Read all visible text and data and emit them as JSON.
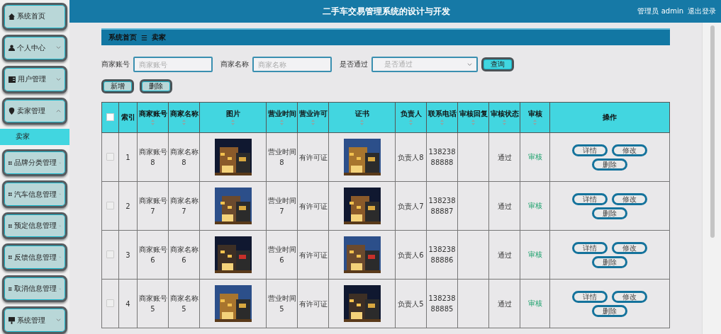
{
  "sidebar": {
    "items": [
      {
        "label": "系统首页"
      },
      {
        "label": "个人中心",
        "expanded": false
      },
      {
        "label": "用户管理",
        "expanded": false
      },
      {
        "label": "卖家管理",
        "expanded": true,
        "children": [
          {
            "label": "卖家",
            "selected": true
          }
        ]
      },
      {
        "label": "品牌分类管理",
        "expanded": false
      },
      {
        "label": "汽车信息管理",
        "expanded": false
      },
      {
        "label": "预定信息管理",
        "expanded": false
      },
      {
        "label": "反馈信息管理",
        "expanded": false
      },
      {
        "label": "取消信息管理",
        "expanded": false
      },
      {
        "label": "系统管理",
        "expanded": false
      }
    ]
  },
  "header": {
    "title": "二手车交易管理系统的设计与开发",
    "user": "管理员 admin",
    "logout": "退出登录"
  },
  "breadcrumb": {
    "home": "系统首页",
    "separator": "☰",
    "current": "卖家"
  },
  "filters": [
    {
      "kind": "input",
      "label": "商家账号",
      "placeholder": "商家账号"
    },
    {
      "kind": "input",
      "label": "商家名称",
      "placeholder": "商家名称"
    },
    {
      "kind": "select",
      "label": "是否通过",
      "placeholder": "是否通过"
    }
  ],
  "search_button": "查询",
  "actions": [
    "新增",
    "删除"
  ],
  "table": {
    "all_checked": false,
    "columns": [
      {
        "kind": "check",
        "sortable": false
      },
      {
        "kind": "text",
        "label": "索引",
        "sortable": false
      },
      {
        "kind": "text",
        "label": "商家账号",
        "sortable": true
      },
      {
        "kind": "text",
        "label": "商家名称",
        "sortable": true
      },
      {
        "kind": "picture",
        "label": "图片",
        "sortable": true
      },
      {
        "kind": "text",
        "label": "营业时间",
        "sortable": true
      },
      {
        "kind": "text",
        "label": "营业许可",
        "sortable": true
      },
      {
        "kind": "picture",
        "label": "证书",
        "sortable": true
      },
      {
        "kind": "text",
        "label": "负责人",
        "sortable": true
      },
      {
        "kind": "text",
        "label": "联系电话",
        "sortable": true
      },
      {
        "kind": "text",
        "label": "审核回复",
        "sortable": true
      },
      {
        "kind": "text",
        "label": "审核状态",
        "sortable": true
      },
      {
        "kind": "link",
        "label": "审核",
        "sortable": true
      },
      {
        "kind": "ops",
        "label": "操作",
        "sortable": false
      }
    ],
    "rows": [
      {
        "checked": false,
        "cells": [
          "",
          "1",
          "商家账号8",
          "商家名称8",
          "",
          "营业时间8",
          "有许可证",
          "",
          "负责人8",
          "13823888888",
          "",
          "通过",
          "审核",
          ""
        ],
        "buttons": [
          "详情",
          "修改",
          "删除"
        ]
      },
      {
        "checked": false,
        "cells": [
          "",
          "2",
          "商家账号7",
          "商家名称7",
          "",
          "营业时间7",
          "有许可证",
          "",
          "负责人7",
          "13823888887",
          "",
          "通过",
          "审核",
          ""
        ],
        "buttons": [
          "详情",
          "修改",
          "删除"
        ]
      },
      {
        "checked": false,
        "cells": [
          "",
          "3",
          "商家账号6",
          "商家名称6",
          "",
          "营业时间6",
          "有许可证",
          "",
          "负责人6",
          "13823888886",
          "",
          "通过",
          "审核",
          ""
        ],
        "buttons": [
          "详情",
          "修改",
          "删除"
        ]
      },
      {
        "checked": false,
        "cells": [
          "",
          "4",
          "商家账号5",
          "商家名称5",
          "",
          "营业时间5",
          "有许可证",
          "",
          "负责人5",
          "13823888885",
          "",
          "通过",
          "审核",
          ""
        ],
        "buttons": [
          "详情",
          "修改",
          "删除"
        ]
      }
    ]
  }
}
